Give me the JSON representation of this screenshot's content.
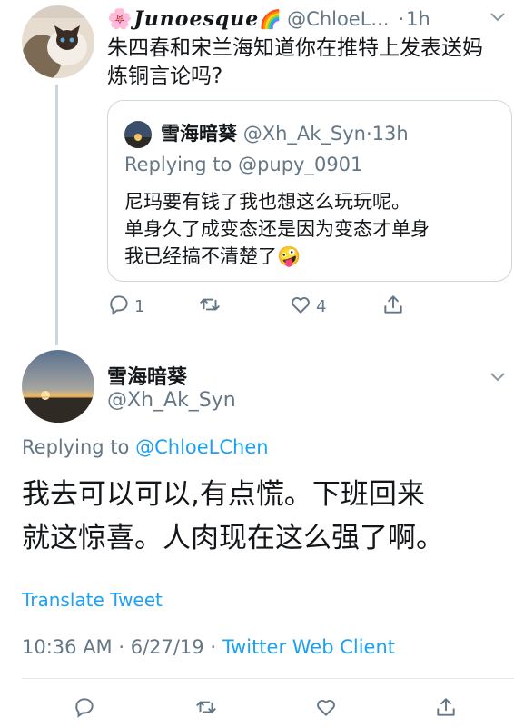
{
  "parent_tweet": {
    "display_name": "Junoesque",
    "name_prefix_emoji": "🌸",
    "name_suffix_emoji": "🌈",
    "handle": "@ChloeL...",
    "dot": "·",
    "time": "1h",
    "text_line1": "朱四春和宋兰海知道你在推特上发表送妈",
    "text_line2": "炼铜言论吗?",
    "quoted": {
      "name": "雪海暗葵",
      "handle": "@Xh_Ak_Syn",
      "dot": "·",
      "time": "13h",
      "replying": "Replying to @pupy_0901",
      "line1": "尼玛要有钱了我也想这么玩玩呢。",
      "line2": "单身久了成变态还是因为变态才单身",
      "line3": "我已经搞不清楚了🤪"
    },
    "actions": {
      "reply_count": "1",
      "like_count": "4"
    }
  },
  "main_tweet": {
    "name": "雪海暗葵",
    "handle": "@Xh_Ak_Syn",
    "replying_prefix": "Replying to",
    "replying_handle": "@ChloeLChen",
    "text_line1": "我去可以可以,有点慌。下班回来",
    "text_line2": "就这惊喜。人肉现在这么强了啊。",
    "translate": "Translate Tweet",
    "timestamp": "10:36 AM · 6/27/19 ·",
    "client": "Twitter Web Client"
  },
  "icons": {
    "reply": "reply-icon",
    "retweet": "retweet-icon",
    "like": "heart-icon",
    "share": "share-icon",
    "caret": "chevron-down-icon"
  },
  "colors": {
    "link": "#1da1f2",
    "muted": "#657786",
    "text": "#14171a",
    "border": "#ccd6dd"
  }
}
